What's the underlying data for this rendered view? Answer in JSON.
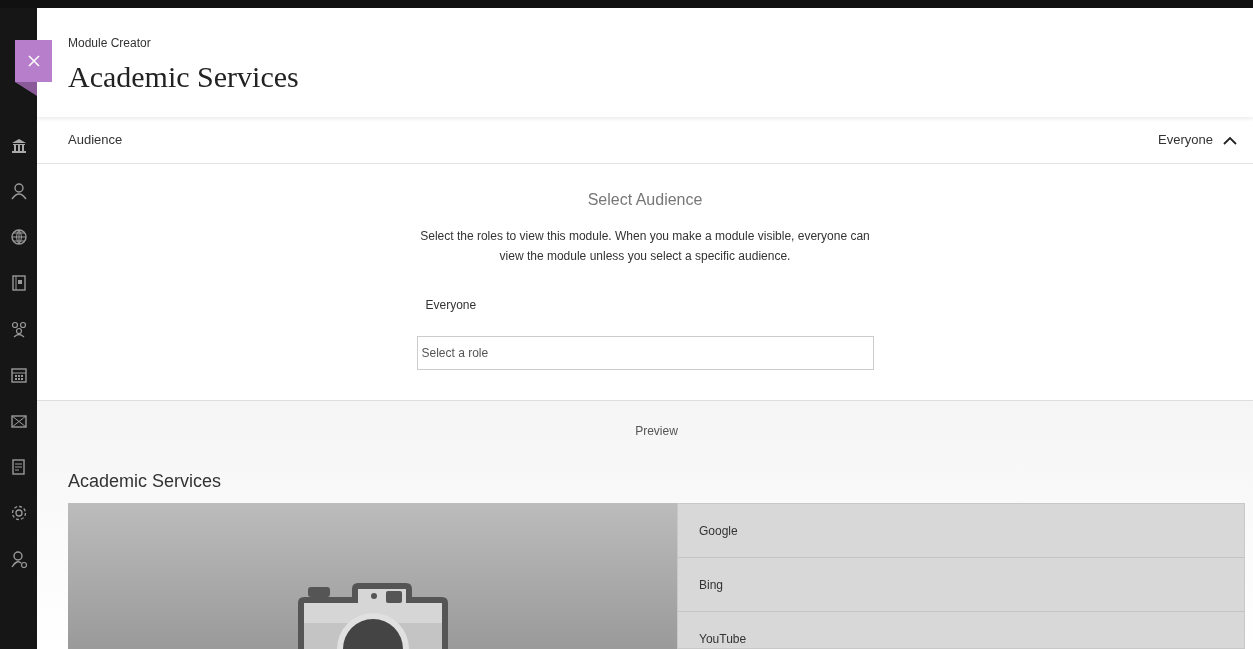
{
  "header": {
    "subtitle": "Module Creator",
    "title": "Academic Services"
  },
  "audience": {
    "label": "Audience",
    "value": "Everyone",
    "expanded": true
  },
  "select_audience": {
    "title": "Select Audience",
    "description": "Select the roles to view this module. When you make a module visible, everyone can view the module unless you select a specific audience.",
    "current": "Everyone",
    "placeholder": "Select a role"
  },
  "preview": {
    "label": "Preview",
    "module_title": "Academic Services",
    "links": [
      "Google",
      "Bing",
      "YouTube"
    ]
  }
}
